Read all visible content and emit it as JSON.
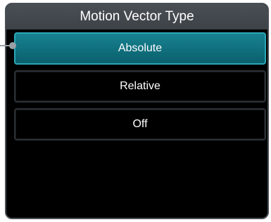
{
  "dialog": {
    "title": "Motion Vector Type",
    "options": [
      {
        "label": "Absolute",
        "selected": true
      },
      {
        "label": "Relative",
        "selected": false
      },
      {
        "label": "Off",
        "selected": false
      }
    ]
  },
  "colors": {
    "selected_fill": "#0f7080",
    "selected_border": "#2aa7b6",
    "title_bar": "#474c52",
    "background": "#000000"
  }
}
